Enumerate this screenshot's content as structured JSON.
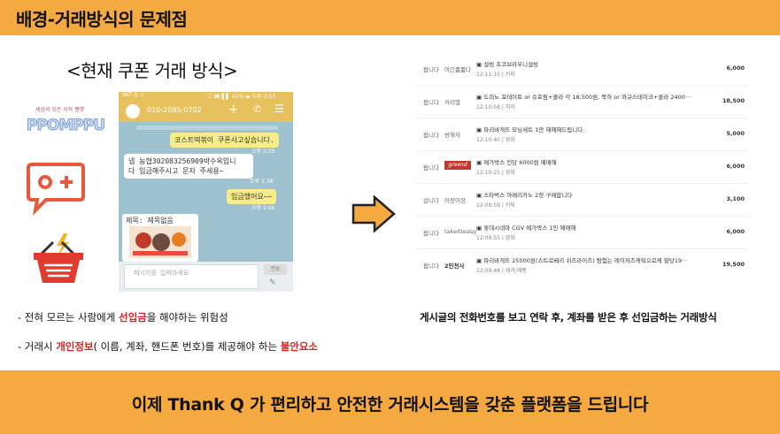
{
  "header": {
    "title": "배경-거래방식의 문제점"
  },
  "subtitle": "<현재 쿠폰 거래 방식>",
  "ppomppu": {
    "tag": "세상의 모든 이득 뽐뿌",
    "name": "PPOMPPU"
  },
  "phone": {
    "status_left": "SKT ◎ ☆",
    "status_right": "☐ ☎ ▌▌ 41% ▬ 오후 2:53",
    "number": "010-2085-0702",
    "messages": [
      {
        "text1": "코스트떡볶이 쿠폰사고싶습니다.",
        "text2": "",
        "time": "오후 1:35"
      },
      {
        "text1": "넵 농협302083256909박수옥입니",
        "text2": "다 입금해주시고 문자 주세용~",
        "time": "오후 1:36"
      },
      {
        "text1": "입금했어요~~",
        "text2": "",
        "time": "오후 1:40"
      }
    ],
    "card_title": "제목: 제목없음",
    "input_placeholder": "메시지를 입력하세요",
    "send_label": "전송"
  },
  "bullets": {
    "b1_pre": "- 전혀 모르는 사람에게 ",
    "b1_em": "선입금",
    "b1_post": "을 해야하는 위험성",
    "b2_pre": "- 거래시 ",
    "b2_em1": "개인정보",
    "b2_mid": "( 이름, 계좌, 핸드폰 번호)를 제공해야 하는 ",
    "b2_em2": "불안요소"
  },
  "board": {
    "rows": [
      {
        "seller": "팝니다",
        "nick": "여긴뽐뽐다",
        "title": "▣ 설빙 초코브라우니설빙",
        "sub": "12:11:10 | 커피",
        "price": "6,000"
      },
      {
        "seller": "팝니다",
        "nick": "커리별",
        "title": "▣ 도미노 포테이토 or 슈프림+콜라 각 18,500원, 쭉하 or 와규스테이크+콜라 2400···",
        "sub": "12:10:58 | 피자",
        "price": "18,500"
      },
      {
        "seller": "팝니다",
        "nick": "방해자",
        "title": "▣ 파리바게뜨 모닝세트 1만 헤헤해드립니다.",
        "sub": "12:10:40 | 영화",
        "price": "5,000"
      },
      {
        "seller": "팝니다",
        "nick": "greend",
        "title": "▣ 메가박스 인당 6000원 예매해",
        "sub": "12:10:25 | 영화",
        "price": "6,000"
      },
      {
        "seller": "삽니다",
        "nick": "어장어장",
        "title": "▣ 스타벅스 아메리카노 2장 구매합니다",
        "sub": "12:09:59 | 커피",
        "price": "3,100"
      },
      {
        "seller": "팝니다",
        "nick": "takeitteasy",
        "title": "▣ 롯데시네마 CGV 메가박스 1인 예매해",
        "sub": "12:09:55 | 영화",
        "price": "6,000"
      },
      {
        "seller": "팝니다",
        "nick": "2민천사",
        "title": "▣ 파리바게뜨 25000원(스트로베리 쉬즈라이즈) 탐험는 레이저즈케잌으로케 할당19···",
        "sub": "12:09:48 | 제과/제빵",
        "price": "19,500"
      }
    ]
  },
  "board_caption": "게시글의 전화번호를 보고 연락 후, 계좌를 받은 후 선입금하는 거래방식",
  "footer": {
    "text": "이제 Thank Q 가 편리하고 안전한 거래시스템을 갖춘 플랫폼을 드립니다"
  }
}
